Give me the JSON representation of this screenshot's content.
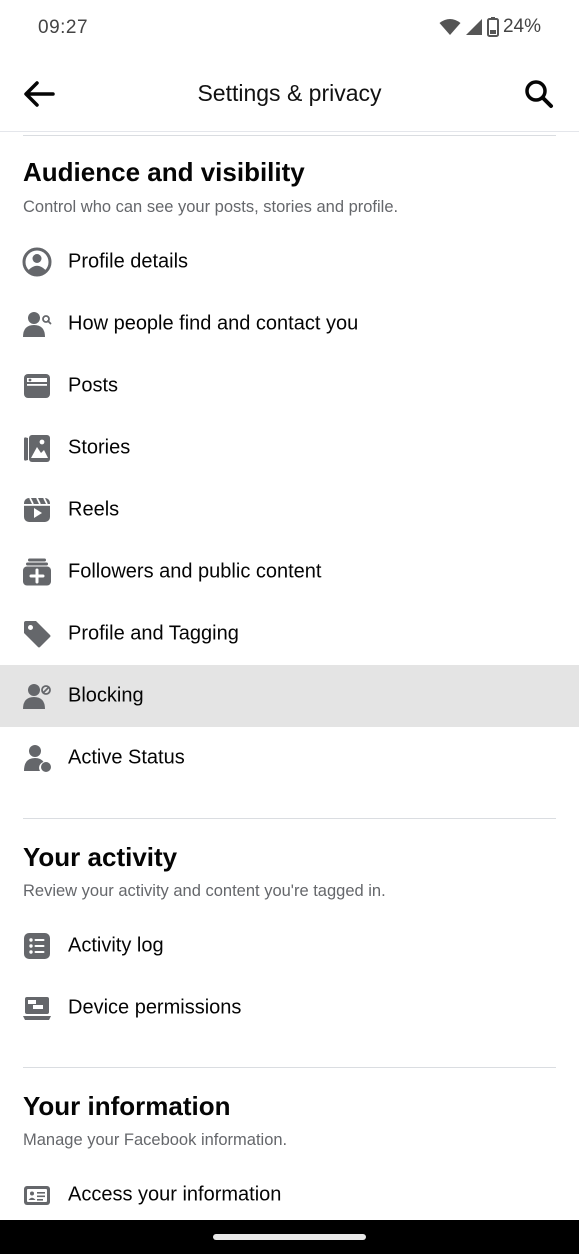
{
  "status": {
    "time": "09:27",
    "battery": "24%",
    "icons": [
      "wifi-icon",
      "signal-icon",
      "battery-icon"
    ]
  },
  "header": {
    "title": "Settings & privacy",
    "back_icon": "arrow-left-icon",
    "search_icon": "search-icon"
  },
  "sections": [
    {
      "title": "Audience and visibility",
      "subtitle": "Control who can see your posts, stories and profile.",
      "items": [
        {
          "label": "Profile details",
          "icon": "profile-circle-icon"
        },
        {
          "label": "How people find and contact you",
          "icon": "person-search-icon"
        },
        {
          "label": "Posts",
          "icon": "post-card-icon"
        },
        {
          "label": "Stories",
          "icon": "stories-icon"
        },
        {
          "label": "Reels",
          "icon": "reels-icon"
        },
        {
          "label": "Followers and public content",
          "icon": "followers-add-icon"
        },
        {
          "label": "Profile and Tagging",
          "icon": "tag-icon"
        },
        {
          "label": "Blocking",
          "icon": "person-block-icon",
          "selected": true
        },
        {
          "label": "Active Status",
          "icon": "person-dot-icon"
        }
      ]
    },
    {
      "title": "Your activity",
      "subtitle": "Review your activity and content you're tagged in.",
      "items": [
        {
          "label": "Activity log",
          "icon": "list-icon"
        },
        {
          "label": "Device permissions",
          "icon": "device-icon"
        }
      ]
    },
    {
      "title": "Your information",
      "subtitle": "Manage your Facebook information.",
      "items": [
        {
          "label": "Access your information",
          "icon": "id-card-icon"
        }
      ]
    }
  ],
  "colors": {
    "icon": "#65676b",
    "text": "#050505",
    "subtext": "#65676b",
    "selected_bg": "#e4e4e4"
  }
}
